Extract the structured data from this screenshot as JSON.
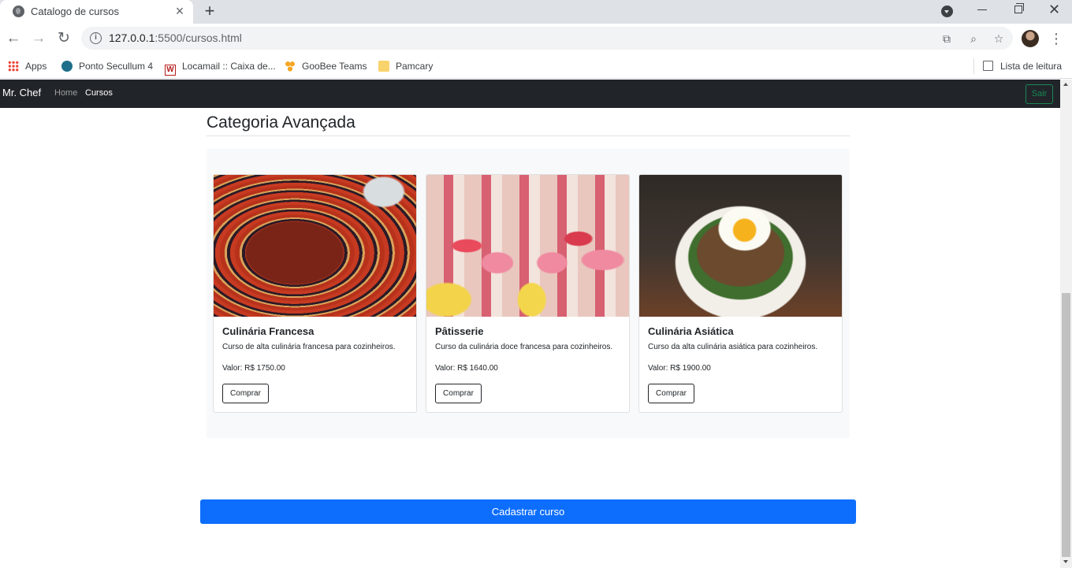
{
  "browser": {
    "tab_title": "Catalogo de cursos",
    "url_host": "127.0.0.1",
    "url_path": ":5500/cursos.html",
    "bookmarks": [
      {
        "label": "Apps",
        "icon": "apps-grid-icon"
      },
      {
        "label": "Ponto Secullum 4",
        "icon": "secullum-icon"
      },
      {
        "label": "Locamail :: Caixa de...",
        "icon": "locamail-icon"
      },
      {
        "label": "GooBee Teams",
        "icon": "goobee-icon"
      },
      {
        "label": "Pamcary",
        "icon": "folder-icon"
      }
    ],
    "reading_list": "Lista de leitura"
  },
  "navbar": {
    "brand": "Mr. Chef",
    "links": [
      "Home",
      "Cursos"
    ],
    "logout_label": "Sair"
  },
  "category": {
    "title": "Categoria Avançada"
  },
  "cards": [
    {
      "title": "Culinária Francesa",
      "text": "Curso de alta culinária francesa para cozinheiros.",
      "price": "Valor: R$ 1750.00",
      "button": "Comprar"
    },
    {
      "title": "Pâtisserie",
      "text": "Curso da culinária doce francesa para cozinheiros.",
      "price": "Valor: R$ 1640.00",
      "button": "Comprar"
    },
    {
      "title": "Culinária Asiática",
      "text": "Curso da alta culinária asiática para cozinheiros.",
      "price": "Valor: R$ 1900.00",
      "button": "Comprar"
    }
  ],
  "actions": {
    "register_label": "Cadastrar curso"
  },
  "colors": {
    "navbar_bg": "#212529",
    "logout_green": "#198754",
    "primary_blue": "#0d6efd",
    "panel_bg": "#f8f9fa"
  }
}
